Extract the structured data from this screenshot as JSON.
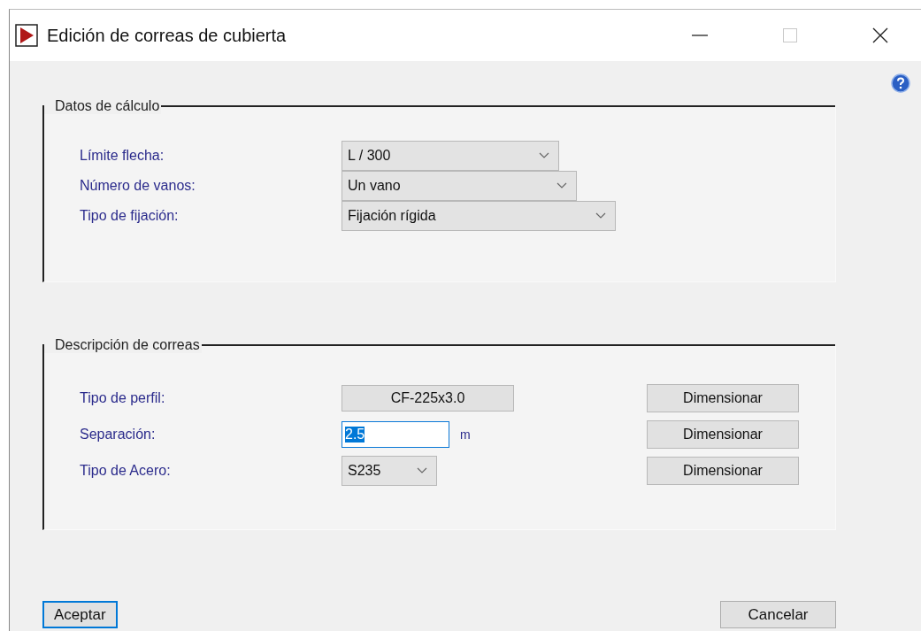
{
  "window": {
    "title": "Edición de correas de cubierta",
    "controls": [
      {
        "kind": "minimize",
        "disabled": false
      },
      {
        "kind": "maximize",
        "disabled": true
      },
      {
        "kind": "close",
        "disabled": false
      }
    ]
  },
  "groups": [
    {
      "title": "Datos de cálculo",
      "rows": [
        {
          "label": "Límite flecha:",
          "kind": "select",
          "value": "L / 300"
        },
        {
          "label": "Número de vanos:",
          "kind": "select",
          "value": "Un vano"
        },
        {
          "label": "Tipo de fijación:",
          "kind": "select",
          "value": "Fijación rígida"
        }
      ]
    },
    {
      "title": "Descripción de correas",
      "rows": [
        {
          "label": "Tipo de perfil:",
          "kind": "button",
          "value": "CF-225x3.0",
          "action": "Dimensionar"
        },
        {
          "label": "Separación:",
          "kind": "input",
          "value": "2.5",
          "highlighted": true,
          "unit": "m",
          "action": "Dimensionar"
        },
        {
          "label": "Tipo de Acero:",
          "kind": "select",
          "value": "S235",
          "action": "Dimensionar"
        }
      ]
    }
  ],
  "buttons": [
    {
      "label": "Aceptar",
      "default": true
    },
    {
      "label": "Cancelar",
      "default": false
    }
  ]
}
